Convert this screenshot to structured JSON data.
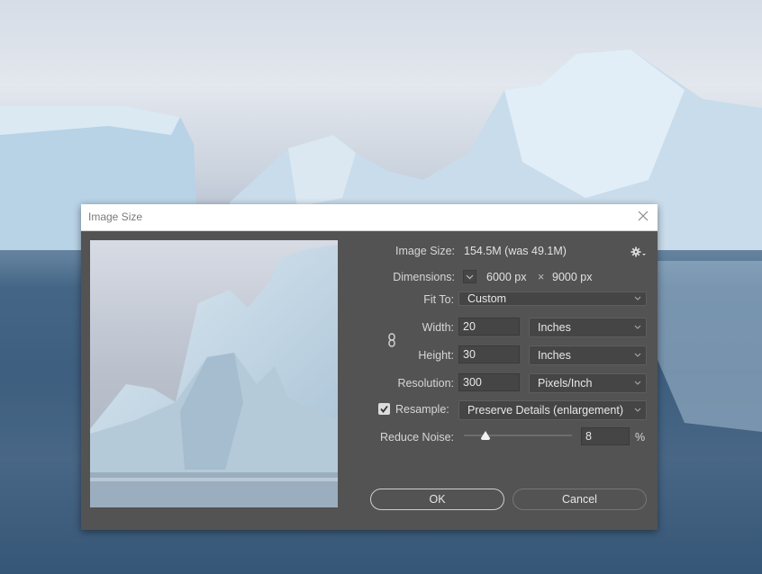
{
  "dialog": {
    "title": "Image Size",
    "image_size_label": "Image Size:",
    "image_size_value": "154.5M (was 49.1M)",
    "dimensions_label": "Dimensions:",
    "dimensions_width": "6000 px",
    "dimensions_times": "×",
    "dimensions_height": "9000 px",
    "fit_to_label": "Fit To:",
    "fit_to_value": "Custom",
    "width_label": "Width:",
    "width_value": "20",
    "width_unit": "Inches",
    "height_label": "Height:",
    "height_value": "30",
    "height_unit": "Inches",
    "resolution_label": "Resolution:",
    "resolution_value": "300",
    "resolution_unit": "Pixels/Inch",
    "resample_label": "Resample:",
    "resample_checked": true,
    "resample_method": "Preserve Details (enlargement)",
    "reduce_noise_label": "Reduce Noise:",
    "reduce_noise_value": "8",
    "reduce_noise_unit": "%",
    "reduce_noise_slider_percent": 8,
    "ok_label": "OK",
    "cancel_label": "Cancel"
  },
  "icons": {
    "close": "close-icon",
    "settings": "gear-icon",
    "dimensions_toggle": "chevron-down-icon",
    "constrain": "link-icon",
    "dropdown": "chevron-down-icon",
    "check": "checkmark-icon"
  },
  "colors": {
    "dialog_bg": "#535353",
    "titlebar_bg": "#ffffff",
    "field_bg": "#454545",
    "text": "#d6d6d6"
  }
}
